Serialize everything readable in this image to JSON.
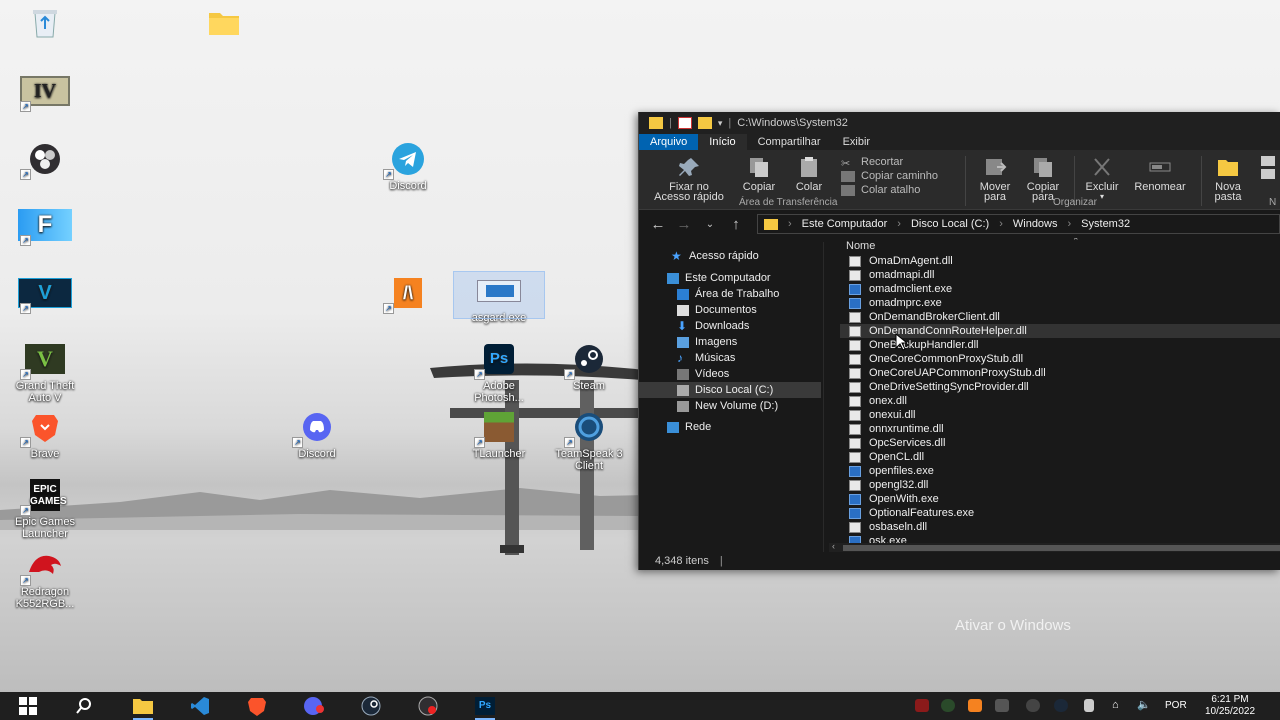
{
  "desktop": {
    "icons": [
      {
        "label": ""
      },
      {
        "label": ""
      },
      {
        "label": ""
      },
      {
        "label": ""
      },
      {
        "label": ""
      },
      {
        "label": ""
      },
      {
        "label": "Grand Theft Auto V"
      },
      {
        "label": "Brave"
      },
      {
        "label": "Epic Games Launcher"
      },
      {
        "label": "Redragon K552RGB..."
      },
      {
        "label": ""
      },
      {
        "label": "Discord"
      },
      {
        "label": ""
      },
      {
        "label": "asgard.exe"
      },
      {
        "label": "Adobe Photosh..."
      },
      {
        "label": "Steam"
      },
      {
        "label": "TLauncher"
      },
      {
        "label": "TeamSpeak 3 Client"
      }
    ],
    "watermark_title": "Ativar o Windows",
    "watermark_sub": ""
  },
  "explorer": {
    "title": "C:\\Windows\\System32",
    "tabs": [
      "Arquivo",
      "Início",
      "Compartilhar",
      "Exibir"
    ],
    "ribbon": {
      "pin_label_1": "Fixar no",
      "pin_label_2": "Acesso rápido",
      "copy": "Copiar",
      "paste": "Colar",
      "cut": "Recortar",
      "copy_path": "Copiar caminho",
      "paste_shortcut": "Colar atalho",
      "clipboard_group": "Área de Transferência",
      "move_1": "Mover",
      "move_2": "para",
      "copyto_1": "Copiar",
      "copyto_2": "para",
      "delete": "Excluir",
      "rename": "Renomear",
      "organize_group": "Organizar",
      "newfolder_1": "Nova",
      "newfolder_2": "pasta",
      "new_group": "N"
    },
    "path": [
      "Este Computador",
      "Disco Local (C:)",
      "Windows",
      "System32"
    ],
    "nav": [
      {
        "label": "Acesso rápido"
      },
      {
        "label": "Este Computador"
      },
      {
        "label": "Área de Trabalho"
      },
      {
        "label": "Documentos"
      },
      {
        "label": "Downloads"
      },
      {
        "label": "Imagens"
      },
      {
        "label": "Músicas"
      },
      {
        "label": "Vídeos"
      },
      {
        "label": "Disco Local (C:)"
      },
      {
        "label": "New Volume (D:)"
      },
      {
        "label": "Rede"
      }
    ],
    "column": "Nome",
    "files": [
      {
        "name": "OmaDmAgent.dll",
        "type": "dll"
      },
      {
        "name": "omadmapi.dll",
        "type": "dll"
      },
      {
        "name": "omadmclient.exe",
        "type": "exe"
      },
      {
        "name": "omadmprc.exe",
        "type": "exe"
      },
      {
        "name": "OnDemandBrokerClient.dll",
        "type": "dll"
      },
      {
        "name": "OnDemandConnRouteHelper.dll",
        "type": "dll"
      },
      {
        "name": "OneBackupHandler.dll",
        "type": "dll"
      },
      {
        "name": "OneCoreCommonProxyStub.dll",
        "type": "dll"
      },
      {
        "name": "OneCoreUAPCommonProxyStub.dll",
        "type": "dll"
      },
      {
        "name": "OneDriveSettingSyncProvider.dll",
        "type": "dll"
      },
      {
        "name": "onex.dll",
        "type": "dll"
      },
      {
        "name": "onexui.dll",
        "type": "dll"
      },
      {
        "name": "onnxruntime.dll",
        "type": "dll"
      },
      {
        "name": "OpcServices.dll",
        "type": "dll"
      },
      {
        "name": "OpenCL.dll",
        "type": "dll"
      },
      {
        "name": "openfiles.exe",
        "type": "exe"
      },
      {
        "name": "opengl32.dll",
        "type": "dll"
      },
      {
        "name": "OpenWith.exe",
        "type": "exe"
      },
      {
        "name": "OptionalFeatures.exe",
        "type": "exe"
      },
      {
        "name": "osbaseln.dll",
        "type": "dll"
      },
      {
        "name": "osk.exe",
        "type": "exe"
      }
    ],
    "status": "4,348 itens"
  },
  "taskbar": {
    "lang": "POR",
    "time": "6:21 PM",
    "date": "10/25/2022",
    "ps": "Ps"
  },
  "colors": {
    "accent": "#0063b1",
    "explorer_bg": "#191919",
    "ribbon_bg": "#2b2b2b",
    "taskbar_bg": "#1f1f1f"
  }
}
